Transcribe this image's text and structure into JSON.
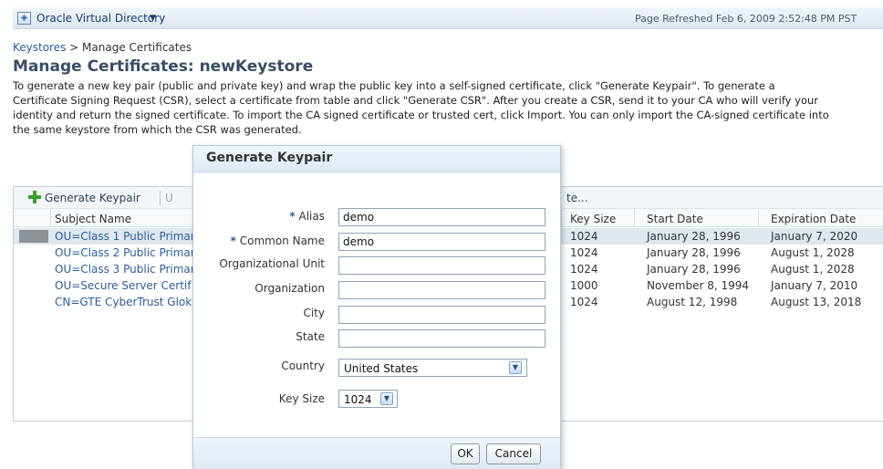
{
  "header": {
    "app_title": "Oracle Virtual Directory",
    "app_menu_arrow": "▼",
    "refreshed": "Page Refreshed Feb 6, 2009 2:52:48 PM PST",
    "refresh_icon": "↻"
  },
  "breadcrumb": {
    "parent": "Keystores",
    "separator": " > ",
    "current": "Manage Certificates"
  },
  "page_title": "Manage Certificates: newKeystore",
  "intro_lines": [
    "To generate a new key pair (public and private key) and wrap the public key into a self-signed certificate, click \"Generate Keypair\". To generate a",
    "Certificate Signing Request (CSR), select a certificate from table and click \"Generate CSR\". After you create a CSR, send it to your CA who will verify your",
    "identity and return the signed certificate. To import the CA signed certificate or trusted cert, click Import. You can only import the CA-signed certificate into",
    "the same keystore from which the CSR was generated."
  ],
  "toolbar": {
    "generate_keypair": "Generate Keypair",
    "hidden_action": "U",
    "import_fragment": "te..."
  },
  "table": {
    "columns": {
      "subject_name": "Subject Name",
      "key_size": "Key Size",
      "start_date": "Start Date",
      "expiration_date": "Expiration Date"
    },
    "rows": [
      {
        "subject": "OU=Class 1 Public Primar",
        "key_size": "1024",
        "start": "January 28, 1996",
        "expiry": "January 7, 2020",
        "selected": true
      },
      {
        "subject": "OU=Class 2 Public Primar",
        "key_size": "1024",
        "start": "January 28, 1996",
        "expiry": "August 1, 2028",
        "selected": false
      },
      {
        "subject": "OU=Class 3 Public Primar",
        "key_size": "1024",
        "start": "January 28, 1996",
        "expiry": "August 1, 2028",
        "selected": false
      },
      {
        "subject": "OU=Secure Server Certif",
        "key_size": "1000",
        "start": "November 8, 1994",
        "expiry": "January 7, 2010",
        "selected": false
      },
      {
        "subject": "CN=GTE CyberTrust Glok",
        "key_size": "1024",
        "start": "August 12, 1998",
        "expiry": "August 13, 2018",
        "selected": false
      }
    ]
  },
  "dialog": {
    "title": "Generate Keypair",
    "required_marker": "*",
    "fields": {
      "alias": {
        "label": "Alias",
        "value": "demo"
      },
      "common_name": {
        "label": "Common Name",
        "value": "demo"
      },
      "org_unit": {
        "label": "Organizational Unit",
        "value": ""
      },
      "organization": {
        "label": "Organization",
        "value": ""
      },
      "city": {
        "label": "City",
        "value": ""
      },
      "state": {
        "label": "State",
        "value": ""
      },
      "country": {
        "label": "Country",
        "value": "United States"
      },
      "key_size": {
        "label": "Key Size",
        "value": "1024"
      }
    },
    "ok_label": "OK",
    "cancel_label": "Cancel"
  },
  "colors": {
    "link": "#2b5c9e",
    "title": "#3a4d66",
    "accent": "#38a12f"
  }
}
